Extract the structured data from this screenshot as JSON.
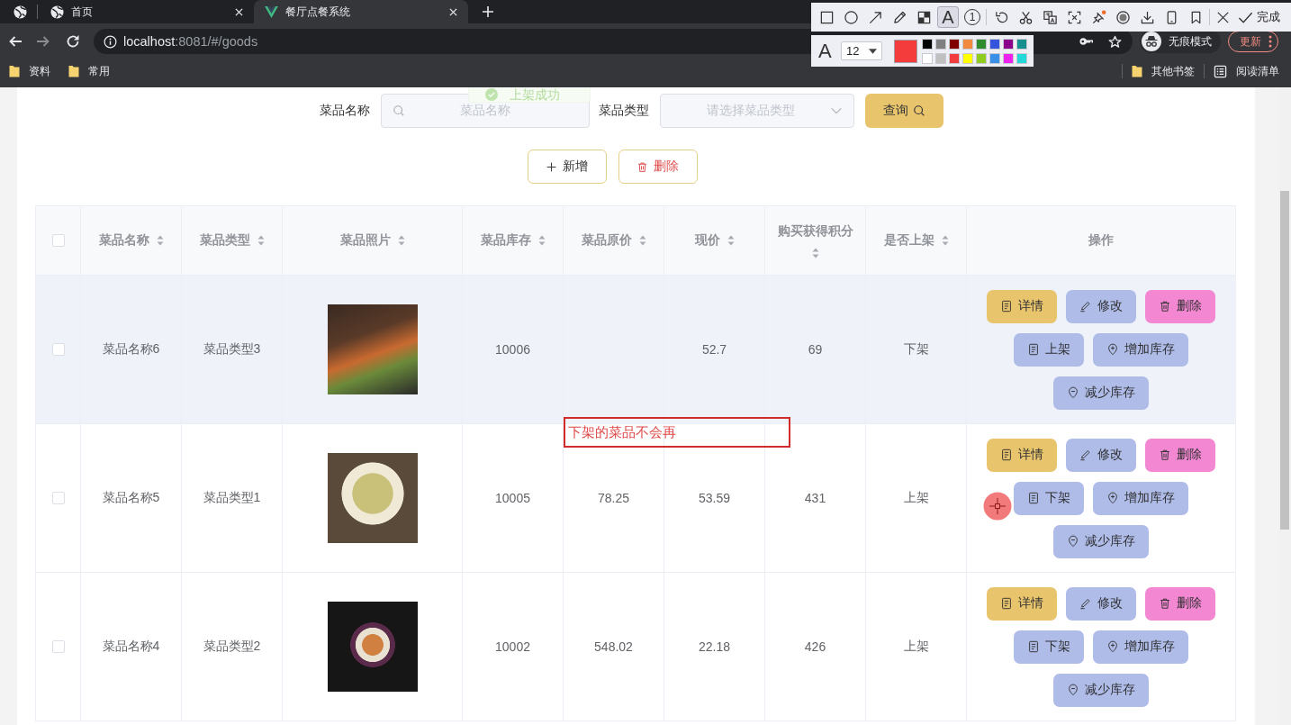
{
  "browser": {
    "tabs": [
      {
        "kind": "pinned",
        "selected": false
      },
      {
        "kind": "site",
        "title": "首页",
        "selected": false
      },
      {
        "kind": "app",
        "title": "餐厅点餐系统",
        "selected": true
      }
    ],
    "address": {
      "host": "localhost",
      "path": ":8081/#/goods"
    },
    "profile_label": "无痕模式",
    "update_button": "更新",
    "bookmarks": [
      {
        "label": "资料"
      },
      {
        "label": "常用"
      }
    ],
    "other_bookmarks": "其他书签",
    "reading_list": "阅读清单"
  },
  "capture_toolbar": {
    "tool_groups": [
      {
        "tools": [
          {
            "kind": "rectangle",
            "selected": false
          },
          {
            "kind": "ellipse",
            "selected": false
          },
          {
            "kind": "arrow",
            "selected": false
          },
          {
            "kind": "pencil",
            "selected": false
          },
          {
            "kind": "mosaic",
            "selected": false
          },
          {
            "kind": "text",
            "glyph": "A",
            "selected": true
          },
          {
            "kind": "number",
            "glyph": "1",
            "selected": false
          }
        ]
      },
      {
        "tools": [
          {
            "kind": "undo",
            "selected": false
          },
          {
            "kind": "cut",
            "selected": false
          },
          {
            "kind": "translate",
            "selected": false
          },
          {
            "kind": "ocr",
            "selected": false
          },
          {
            "kind": "pin",
            "selected": false
          },
          {
            "kind": "record",
            "selected": false
          },
          {
            "kind": "download",
            "selected": false
          },
          {
            "kind": "phone",
            "selected": false
          },
          {
            "kind": "bookmark",
            "selected": false
          }
        ]
      },
      {
        "tools": [
          {
            "kind": "close",
            "selected": false
          }
        ]
      }
    ],
    "done_button": "完成",
    "text_options": {
      "glyph": "A",
      "font_size": "12",
      "palette": [
        {
          "color": "#000000"
        },
        {
          "color": "#808080"
        },
        {
          "color": "#800000"
        },
        {
          "color": "#f08a3c"
        },
        {
          "color": "#2e8b2e"
        },
        {
          "color": "#3355dd"
        },
        {
          "color": "#8b008b"
        },
        {
          "color": "#178f8f"
        },
        {
          "color": "#ffffff"
        },
        {
          "color": "#c0c0c0"
        },
        {
          "color": "#f03c3c"
        },
        {
          "color": "#ffff00"
        },
        {
          "color": "#8fcc1f"
        },
        {
          "color": "#3a8fe6"
        },
        {
          "color": "#ee22ee"
        },
        {
          "color": "#22d8d8"
        }
      ]
    }
  },
  "toast": {
    "text": "上架成功"
  },
  "search": {
    "fields": [
      {
        "kind": "text",
        "label": "菜品名称",
        "placeholder": "菜品名称"
      },
      {
        "kind": "select",
        "label": "菜品类型",
        "placeholder": "请选择菜品类型"
      }
    ],
    "query_button": "查询"
  },
  "actions": [
    {
      "kind": "add",
      "label": "新增"
    },
    {
      "kind": "delete",
      "label": "删除"
    }
  ],
  "table": {
    "select_all": {
      "checked": false
    },
    "columns": [
      {
        "label": "菜品名称",
        "sortable": true
      },
      {
        "label": "菜品类型",
        "sortable": true
      },
      {
        "label": "菜品照片",
        "sortable": true
      },
      {
        "label": "菜品库存",
        "sortable": true
      },
      {
        "label": "菜品原价",
        "sortable": true
      },
      {
        "label": "现价",
        "sortable": true
      },
      {
        "label": "购买获得积分",
        "sortable": true
      },
      {
        "label": "是否上架",
        "sortable": true
      },
      {
        "label": "操作",
        "sortable": false
      }
    ],
    "rows": [
      {
        "checked": false,
        "highlighted": true,
        "name": "菜品名称6",
        "type": "菜品类型3",
        "stock": "10006",
        "current_price": "52.7",
        "points": "69",
        "status": "下架",
        "actions": [
          {
            "kind": "detail",
            "label": "详情"
          },
          {
            "kind": "edit",
            "label": "修改"
          },
          {
            "kind": "delete",
            "label": "删除"
          },
          {
            "kind": "status",
            "label": "上架"
          },
          {
            "kind": "add-stock",
            "label": "增加库存"
          },
          {
            "kind": "reduce-stock",
            "label": "减少库存"
          }
        ]
      },
      {
        "checked": false,
        "highlighted": false,
        "name": "菜品名称5",
        "type": "菜品类型1",
        "stock": "10005",
        "original_price": "78.25",
        "current_price": "53.59",
        "points": "431",
        "status": "上架",
        "actions": [
          {
            "kind": "detail",
            "label": "详情"
          },
          {
            "kind": "edit",
            "label": "修改"
          },
          {
            "kind": "delete",
            "label": "删除"
          },
          {
            "kind": "status",
            "label": "下架"
          },
          {
            "kind": "add-stock",
            "label": "增加库存"
          },
          {
            "kind": "reduce-stock",
            "label": "减少库存"
          }
        ]
      },
      {
        "checked": false,
        "highlighted": false,
        "name": "菜品名称4",
        "type": "菜品类型2",
        "stock": "10002",
        "original_price": "548.02",
        "current_price": "22.18",
        "points": "426",
        "status": "上架",
        "actions": [
          {
            "kind": "detail",
            "label": "详情"
          },
          {
            "kind": "edit",
            "label": "修改"
          },
          {
            "kind": "delete",
            "label": "删除"
          },
          {
            "kind": "status",
            "label": "下架"
          },
          {
            "kind": "add-stock",
            "label": "增加库存"
          },
          {
            "kind": "reduce-stock",
            "label": "减少库存"
          }
        ]
      }
    ]
  },
  "annotation": {
    "text": "下架的菜品不会再"
  }
}
